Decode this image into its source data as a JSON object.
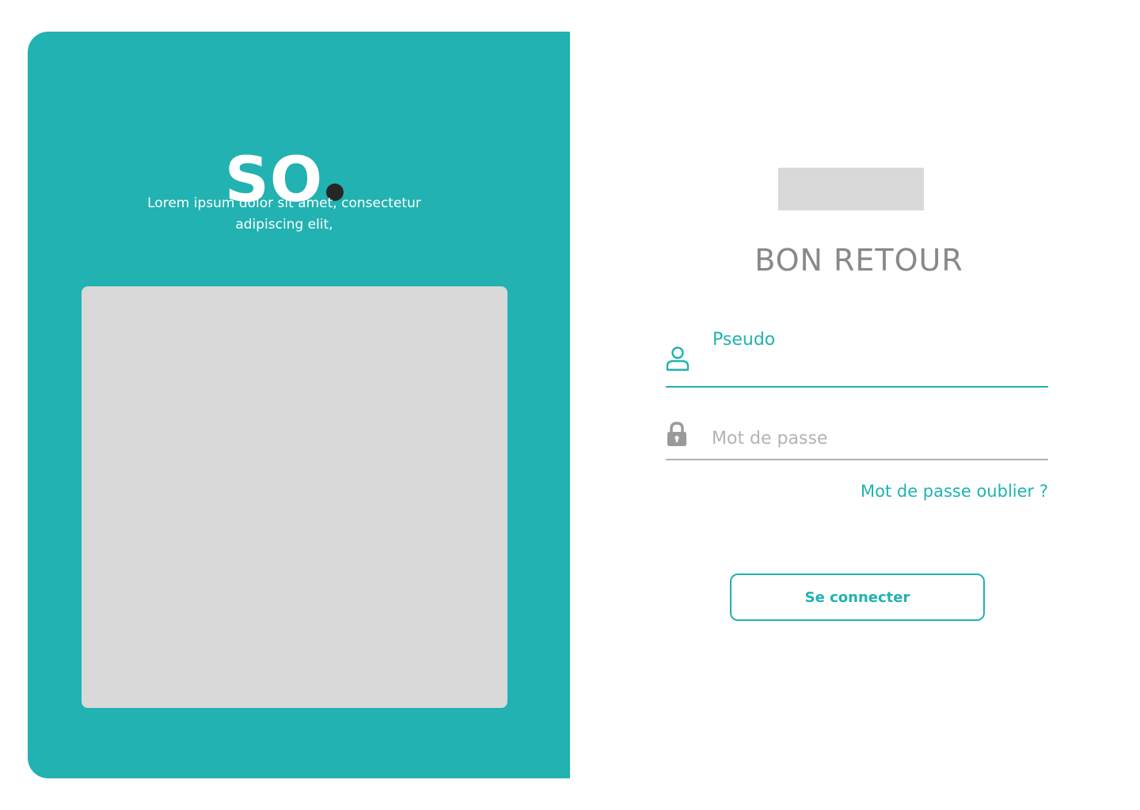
{
  "brand": {
    "logo_text": "SO",
    "tagline": "Lorem ipsum dolor sit amet, consectetur adipiscing elit,"
  },
  "colors": {
    "accent": "#21b2b1",
    "logo_dot": "#262626",
    "placeholder_gray": "#d9d9d9",
    "heading_gray": "#888888"
  },
  "login": {
    "heading": "BON RETOUR",
    "username": {
      "label": "Pseudo",
      "value": "",
      "icon": "user-icon"
    },
    "password": {
      "placeholder": "Mot de passe",
      "value": "",
      "icon": "lock-icon"
    },
    "forgot_password_label": "Mot de passe oublier ?",
    "submit_label": "Se connecter"
  }
}
